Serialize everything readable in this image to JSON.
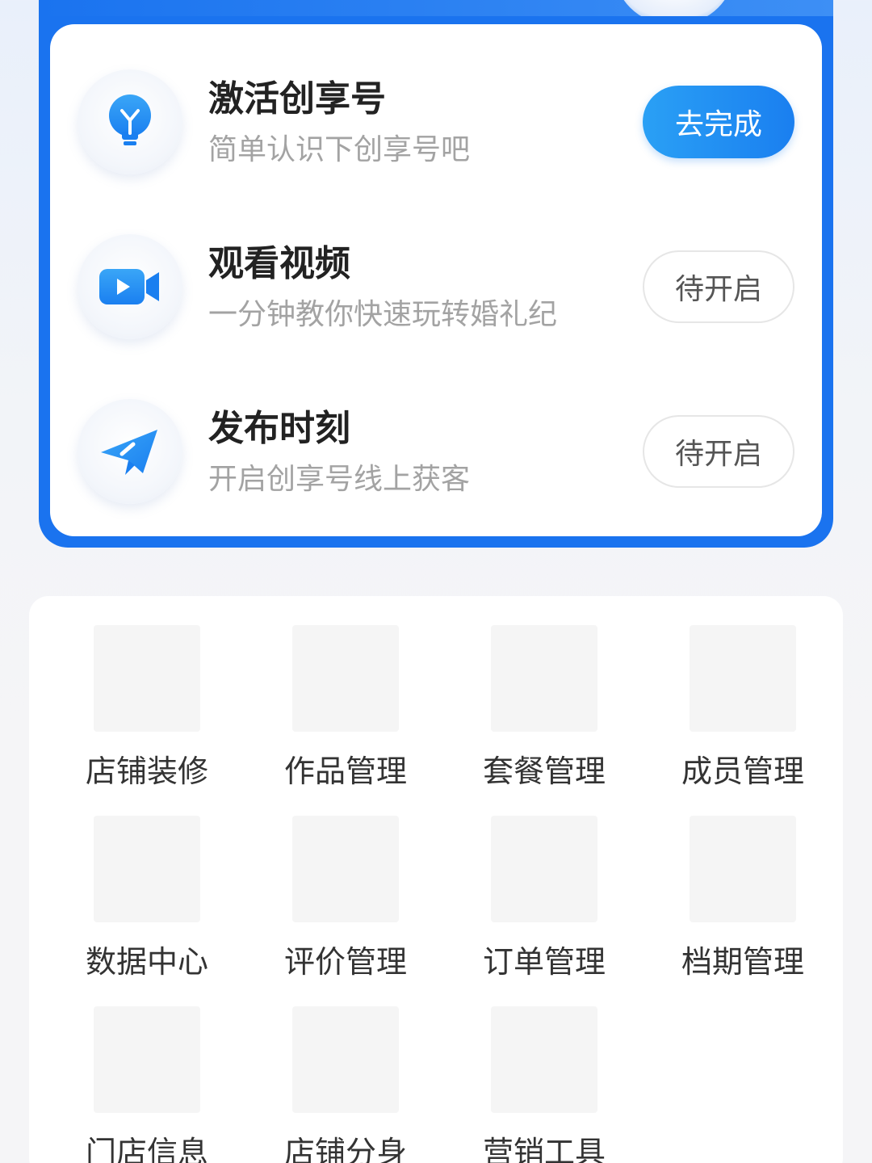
{
  "tasks": [
    {
      "title": "激活创享号",
      "desc": "简单认识下创享号吧",
      "button": "去完成",
      "icon": "lightbulb-icon",
      "state": "primary"
    },
    {
      "title": "观看视频",
      "desc": "一分钟教你快速玩转婚礼纪",
      "button": "待开启",
      "icon": "video-camera-icon",
      "state": "pending"
    },
    {
      "title": "发布时刻",
      "desc": "开启创享号线上获客",
      "button": "待开启",
      "icon": "paper-plane-icon",
      "state": "pending"
    }
  ],
  "menu": [
    {
      "label": "店铺装修"
    },
    {
      "label": "作品管理"
    },
    {
      "label": "套餐管理"
    },
    {
      "label": "成员管理"
    },
    {
      "label": "数据中心"
    },
    {
      "label": "评价管理"
    },
    {
      "label": "订单管理"
    },
    {
      "label": "档期管理"
    },
    {
      "label": "门店信息"
    },
    {
      "label": "店铺分身"
    },
    {
      "label": "营销工具"
    }
  ],
  "colors": {
    "accent": "#1a73ef",
    "button_gradient_start": "#2aa0f5",
    "button_gradient_end": "#1a7ff0"
  }
}
